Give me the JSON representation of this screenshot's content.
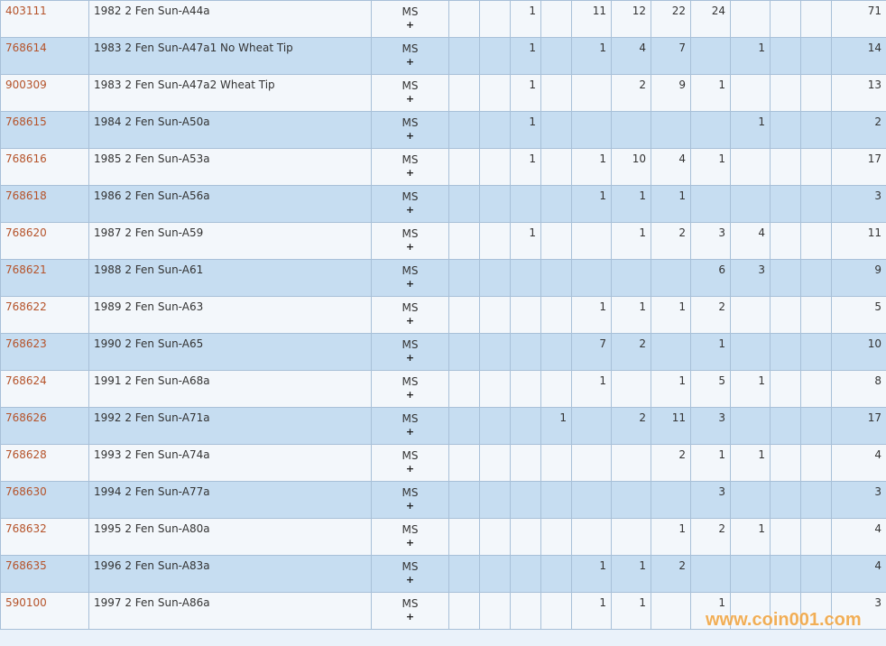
{
  "rows": [
    {
      "id": "403111",
      "name": "1982 2 Fen Sun-A44a",
      "grade": "MS",
      "plus": "+",
      "counts": [
        "",
        "",
        "1",
        "",
        "11",
        "12",
        "22",
        "24",
        "",
        "",
        ""
      ],
      "total": "71"
    },
    {
      "id": "768614",
      "name": "1983 2 Fen Sun-A47a1 No Wheat Tip",
      "grade": "MS",
      "plus": "+",
      "counts": [
        "",
        "",
        "1",
        "",
        "1",
        "4",
        "7",
        "",
        "1",
        "",
        ""
      ],
      "total": "14"
    },
    {
      "id": "900309",
      "name": "1983 2 Fen Sun-A47a2 Wheat Tip",
      "grade": "MS",
      "plus": "+",
      "counts": [
        "",
        "",
        "1",
        "",
        "",
        "2",
        "9",
        "1",
        "",
        "",
        ""
      ],
      "total": "13"
    },
    {
      "id": "768615",
      "name": "1984 2 Fen Sun-A50a",
      "grade": "MS",
      "plus": "+",
      "counts": [
        "",
        "",
        "1",
        "",
        "",
        "",
        "",
        "",
        "1",
        "",
        ""
      ],
      "total": "2"
    },
    {
      "id": "768616",
      "name": "1985 2 Fen Sun-A53a",
      "grade": "MS",
      "plus": "+",
      "counts": [
        "",
        "",
        "1",
        "",
        "1",
        "10",
        "4",
        "1",
        "",
        "",
        ""
      ],
      "total": "17"
    },
    {
      "id": "768618",
      "name": "1986 2 Fen Sun-A56a",
      "grade": "MS",
      "plus": "+",
      "counts": [
        "",
        "",
        "",
        "",
        "1",
        "1",
        "1",
        "",
        "",
        "",
        ""
      ],
      "total": "3"
    },
    {
      "id": "768620",
      "name": "1987 2 Fen Sun-A59",
      "grade": "MS",
      "plus": "+",
      "counts": [
        "",
        "",
        "1",
        "",
        "",
        "1",
        "2",
        "3",
        "4",
        "",
        ""
      ],
      "total": "11"
    },
    {
      "id": "768621",
      "name": "1988 2 Fen Sun-A61",
      "grade": "MS",
      "plus": "+",
      "counts": [
        "",
        "",
        "",
        "",
        "",
        "",
        "",
        "6",
        "3",
        "",
        ""
      ],
      "total": "9"
    },
    {
      "id": "768622",
      "name": "1989 2 Fen Sun-A63",
      "grade": "MS",
      "plus": "+",
      "counts": [
        "",
        "",
        "",
        "",
        "1",
        "1",
        "1",
        "2",
        "",
        "",
        ""
      ],
      "total": "5"
    },
    {
      "id": "768623",
      "name": "1990 2 Fen Sun-A65",
      "grade": "MS",
      "plus": "+",
      "counts": [
        "",
        "",
        "",
        "",
        "7",
        "2",
        "",
        "1",
        "",
        "",
        ""
      ],
      "total": "10"
    },
    {
      "id": "768624",
      "name": "1991 2 Fen Sun-A68a",
      "grade": "MS",
      "plus": "+",
      "counts": [
        "",
        "",
        "",
        "",
        "1",
        "",
        "1",
        "5",
        "1",
        "",
        ""
      ],
      "total": "8"
    },
    {
      "id": "768626",
      "name": "1992 2 Fen Sun-A71a",
      "grade": "MS",
      "plus": "+",
      "counts": [
        "",
        "",
        "",
        "1",
        "",
        "2",
        "11",
        "3",
        "",
        "",
        ""
      ],
      "total": "17"
    },
    {
      "id": "768628",
      "name": "1993 2 Fen Sun-A74a",
      "grade": "MS",
      "plus": "+",
      "counts": [
        "",
        "",
        "",
        "",
        "",
        "",
        "2",
        "1",
        "1",
        "",
        ""
      ],
      "total": "4"
    },
    {
      "id": "768630",
      "name": "1994 2 Fen Sun-A77a",
      "grade": "MS",
      "plus": "+",
      "counts": [
        "",
        "",
        "",
        "",
        "",
        "",
        "",
        "3",
        "",
        "",
        ""
      ],
      "total": "3"
    },
    {
      "id": "768632",
      "name": "1995 2 Fen Sun-A80a",
      "grade": "MS",
      "plus": "+",
      "counts": [
        "",
        "",
        "",
        "",
        "",
        "",
        "1",
        "2",
        "1",
        "",
        ""
      ],
      "total": "4"
    },
    {
      "id": "768635",
      "name": "1996 2 Fen Sun-A83a",
      "grade": "MS",
      "plus": "+",
      "counts": [
        "",
        "",
        "",
        "",
        "1",
        "1",
        "2",
        "",
        "",
        "",
        ""
      ],
      "total": "4"
    },
    {
      "id": "590100",
      "name": "1997 2 Fen Sun-A86a",
      "grade": "MS",
      "plus": "+",
      "counts": [
        "",
        "",
        "",
        "",
        "1",
        "1",
        "",
        "1",
        "",
        "",
        ""
      ],
      "total": "3"
    }
  ],
  "watermark": "www.coin001.com"
}
